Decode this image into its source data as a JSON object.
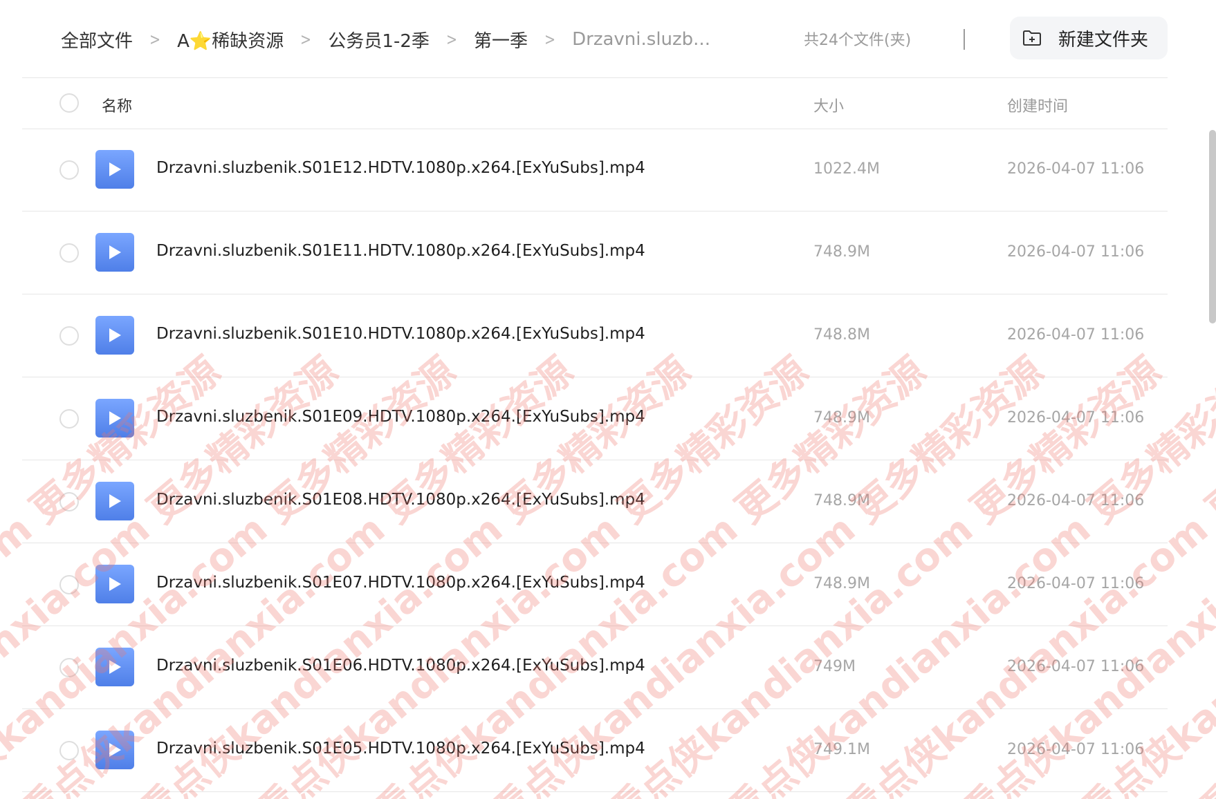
{
  "breadcrumb": {
    "items": [
      {
        "label": "全部文件"
      },
      {
        "prefix": "A",
        "star": "⭐",
        "label": "稀缺资源"
      },
      {
        "label": "公务员1-2季"
      },
      {
        "label": "第一季"
      },
      {
        "label": "Drzavni.sluzb..."
      }
    ],
    "separator": ">"
  },
  "file_count": "共24个文件(夹)",
  "new_folder_button": {
    "label": "新建文件夹",
    "icon": "folder-plus-icon"
  },
  "table": {
    "columns": {
      "name": "名称",
      "size": "大小",
      "created": "创建时间"
    },
    "rows": [
      {
        "name": "Drzavni.sluzbenik.S01E12.HDTV.1080p.x264.[ExYuSubs].mp4",
        "size": "1022.4M",
        "created": "2026-04-07 11:06"
      },
      {
        "name": "Drzavni.sluzbenik.S01E11.HDTV.1080p.x264.[ExYuSubs].mp4",
        "size": "748.9M",
        "created": "2026-04-07 11:06"
      },
      {
        "name": "Drzavni.sluzbenik.S01E10.HDTV.1080p.x264.[ExYuSubs].mp4",
        "size": "748.8M",
        "created": "2026-04-07 11:06"
      },
      {
        "name": "Drzavni.sluzbenik.S01E09.HDTV.1080p.x264.[ExYuSubs].mp4",
        "size": "748.9M",
        "created": "2026-04-07 11:06"
      },
      {
        "name": "Drzavni.sluzbenik.S01E08.HDTV.1080p.x264.[ExYuSubs].mp4",
        "size": "748.9M",
        "created": "2026-04-07 11:06"
      },
      {
        "name": "Drzavni.sluzbenik.S01E07.HDTV.1080p.x264.[ExYuSubs].mp4",
        "size": "748.9M",
        "created": "2026-04-07 11:06"
      },
      {
        "name": "Drzavni.sluzbenik.S01E06.HDTV.1080p.x264.[ExYuSubs].mp4",
        "size": "749M",
        "created": "2026-04-07 11:06"
      },
      {
        "name": "Drzavni.sluzbenik.S01E05.HDTV.1080p.x264.[ExYuSubs].mp4",
        "size": "749.1M",
        "created": "2026-04-07 11:06"
      }
    ]
  },
  "file_icon": "video-play-icon",
  "colors": {
    "file_icon": "#5b8af0",
    "watermark": "#f0786e"
  },
  "watermark_text": "看点侠kandianxia.com  更多精彩资源"
}
